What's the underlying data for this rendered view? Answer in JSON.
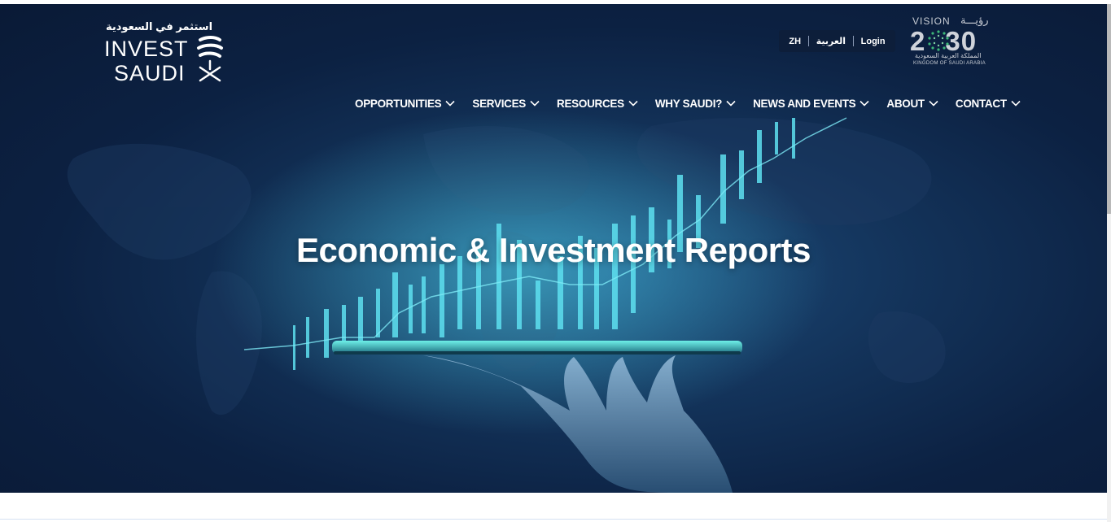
{
  "brand": {
    "arabic_tagline": "استثمر في السعودية",
    "word1": "INVEST",
    "word2": "SAUDI",
    "mark_icon": "invest-saudi-mark-icon"
  },
  "utility": {
    "lang_zh": "ZH",
    "lang_ar": "العربية",
    "login": "Login"
  },
  "vision": {
    "word": "VISION",
    "arabic": "رؤيـــة",
    "year_left": "2",
    "year_right": "30",
    "sub_ar": "المملكة العربية السعودية",
    "sub_en": "KINGDOM OF SAUDI ARABIA"
  },
  "nav": {
    "items": [
      {
        "label": "OPPORTUNITIES",
        "icon": "chevron-down-icon"
      },
      {
        "label": "SERVICES",
        "icon": "chevron-down-icon"
      },
      {
        "label": "RESOURCES",
        "icon": "chevron-down-icon"
      },
      {
        "label": "WHY SAUDI?",
        "icon": "chevron-down-icon"
      },
      {
        "label": "NEWS AND EVENTS",
        "icon": "chevron-down-icon"
      },
      {
        "label": "ABOUT",
        "icon": "chevron-down-icon"
      },
      {
        "label": "CONTACT",
        "icon": "chevron-down-icon"
      }
    ]
  },
  "hero": {
    "title": "Economic & Investment Reports"
  },
  "colors": {
    "hero_dark": "#0a1a36",
    "hero_mid": "#1d4c7c",
    "accent_teal": "#3fd6e0"
  }
}
